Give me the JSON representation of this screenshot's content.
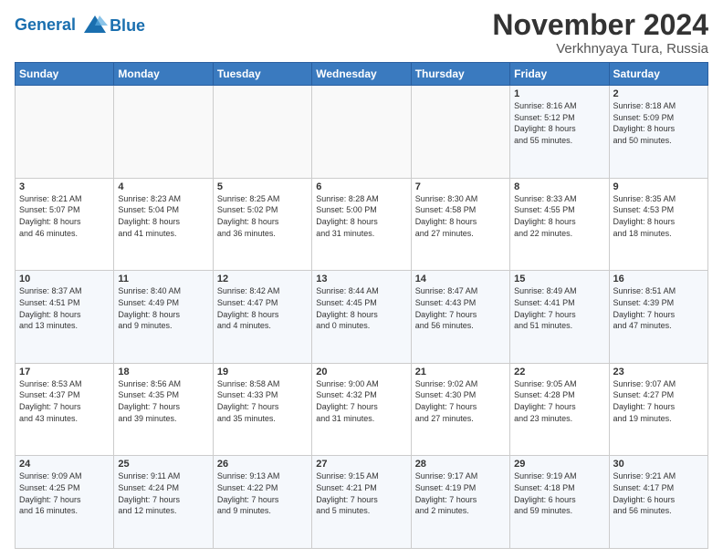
{
  "logo": {
    "line1": "General",
    "line2": "Blue"
  },
  "title": "November 2024",
  "location": "Verkhnyaya Tura, Russia",
  "weekdays": [
    "Sunday",
    "Monday",
    "Tuesday",
    "Wednesday",
    "Thursday",
    "Friday",
    "Saturday"
  ],
  "weeks": [
    [
      {
        "day": "",
        "info": ""
      },
      {
        "day": "",
        "info": ""
      },
      {
        "day": "",
        "info": ""
      },
      {
        "day": "",
        "info": ""
      },
      {
        "day": "",
        "info": ""
      },
      {
        "day": "1",
        "info": "Sunrise: 8:16 AM\nSunset: 5:12 PM\nDaylight: 8 hours\nand 55 minutes."
      },
      {
        "day": "2",
        "info": "Sunrise: 8:18 AM\nSunset: 5:09 PM\nDaylight: 8 hours\nand 50 minutes."
      }
    ],
    [
      {
        "day": "3",
        "info": "Sunrise: 8:21 AM\nSunset: 5:07 PM\nDaylight: 8 hours\nand 46 minutes."
      },
      {
        "day": "4",
        "info": "Sunrise: 8:23 AM\nSunset: 5:04 PM\nDaylight: 8 hours\nand 41 minutes."
      },
      {
        "day": "5",
        "info": "Sunrise: 8:25 AM\nSunset: 5:02 PM\nDaylight: 8 hours\nand 36 minutes."
      },
      {
        "day": "6",
        "info": "Sunrise: 8:28 AM\nSunset: 5:00 PM\nDaylight: 8 hours\nand 31 minutes."
      },
      {
        "day": "7",
        "info": "Sunrise: 8:30 AM\nSunset: 4:58 PM\nDaylight: 8 hours\nand 27 minutes."
      },
      {
        "day": "8",
        "info": "Sunrise: 8:33 AM\nSunset: 4:55 PM\nDaylight: 8 hours\nand 22 minutes."
      },
      {
        "day": "9",
        "info": "Sunrise: 8:35 AM\nSunset: 4:53 PM\nDaylight: 8 hours\nand 18 minutes."
      }
    ],
    [
      {
        "day": "10",
        "info": "Sunrise: 8:37 AM\nSunset: 4:51 PM\nDaylight: 8 hours\nand 13 minutes."
      },
      {
        "day": "11",
        "info": "Sunrise: 8:40 AM\nSunset: 4:49 PM\nDaylight: 8 hours\nand 9 minutes."
      },
      {
        "day": "12",
        "info": "Sunrise: 8:42 AM\nSunset: 4:47 PM\nDaylight: 8 hours\nand 4 minutes."
      },
      {
        "day": "13",
        "info": "Sunrise: 8:44 AM\nSunset: 4:45 PM\nDaylight: 8 hours\nand 0 minutes."
      },
      {
        "day": "14",
        "info": "Sunrise: 8:47 AM\nSunset: 4:43 PM\nDaylight: 7 hours\nand 56 minutes."
      },
      {
        "day": "15",
        "info": "Sunrise: 8:49 AM\nSunset: 4:41 PM\nDaylight: 7 hours\nand 51 minutes."
      },
      {
        "day": "16",
        "info": "Sunrise: 8:51 AM\nSunset: 4:39 PM\nDaylight: 7 hours\nand 47 minutes."
      }
    ],
    [
      {
        "day": "17",
        "info": "Sunrise: 8:53 AM\nSunset: 4:37 PM\nDaylight: 7 hours\nand 43 minutes."
      },
      {
        "day": "18",
        "info": "Sunrise: 8:56 AM\nSunset: 4:35 PM\nDaylight: 7 hours\nand 39 minutes."
      },
      {
        "day": "19",
        "info": "Sunrise: 8:58 AM\nSunset: 4:33 PM\nDaylight: 7 hours\nand 35 minutes."
      },
      {
        "day": "20",
        "info": "Sunrise: 9:00 AM\nSunset: 4:32 PM\nDaylight: 7 hours\nand 31 minutes."
      },
      {
        "day": "21",
        "info": "Sunrise: 9:02 AM\nSunset: 4:30 PM\nDaylight: 7 hours\nand 27 minutes."
      },
      {
        "day": "22",
        "info": "Sunrise: 9:05 AM\nSunset: 4:28 PM\nDaylight: 7 hours\nand 23 minutes."
      },
      {
        "day": "23",
        "info": "Sunrise: 9:07 AM\nSunset: 4:27 PM\nDaylight: 7 hours\nand 19 minutes."
      }
    ],
    [
      {
        "day": "24",
        "info": "Sunrise: 9:09 AM\nSunset: 4:25 PM\nDaylight: 7 hours\nand 16 minutes."
      },
      {
        "day": "25",
        "info": "Sunrise: 9:11 AM\nSunset: 4:24 PM\nDaylight: 7 hours\nand 12 minutes."
      },
      {
        "day": "26",
        "info": "Sunrise: 9:13 AM\nSunset: 4:22 PM\nDaylight: 7 hours\nand 9 minutes."
      },
      {
        "day": "27",
        "info": "Sunrise: 9:15 AM\nSunset: 4:21 PM\nDaylight: 7 hours\nand 5 minutes."
      },
      {
        "day": "28",
        "info": "Sunrise: 9:17 AM\nSunset: 4:19 PM\nDaylight: 7 hours\nand 2 minutes."
      },
      {
        "day": "29",
        "info": "Sunrise: 9:19 AM\nSunset: 4:18 PM\nDaylight: 6 hours\nand 59 minutes."
      },
      {
        "day": "30",
        "info": "Sunrise: 9:21 AM\nSunset: 4:17 PM\nDaylight: 6 hours\nand 56 minutes."
      }
    ]
  ]
}
